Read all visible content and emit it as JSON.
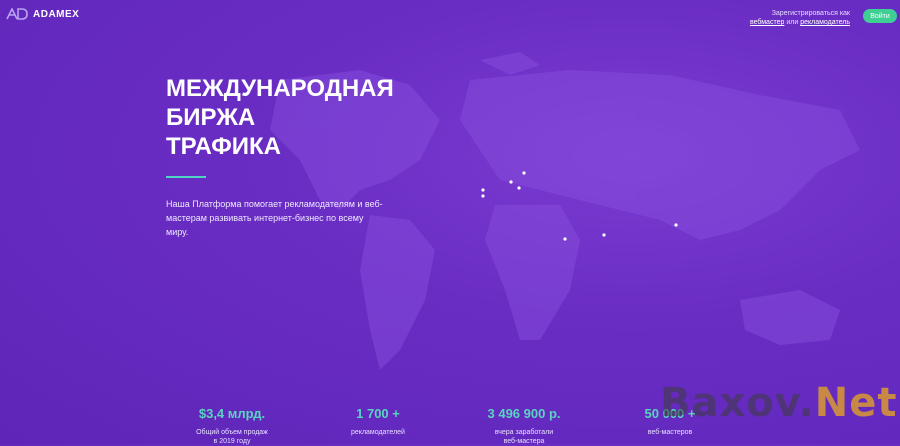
{
  "header": {
    "logo_text": "ADAMEX",
    "register_prefix": "Зарегистрироваться как",
    "register_webmaster": "вебмастер",
    "register_or": "или",
    "register_advertiser": "рекламодатель",
    "login_label": "Войти"
  },
  "hero": {
    "title_lines": [
      "МЕЖДУНАРОДНАЯ",
      "БИРЖА",
      "ТРАФИКА"
    ],
    "description": "Наша Платформа помогает рекламодателям и веб-мастерам развивать интернет-бизнес по всему миру."
  },
  "stats": [
    {
      "value": "$3,4 млрд.",
      "label_lines": [
        "Общий объем продаж",
        "в 2019 году"
      ]
    },
    {
      "value": "1 700 +",
      "label_lines": [
        "рекламодателей"
      ]
    },
    {
      "value": "3 496 900 р.",
      "label_lines": [
        "вчера заработали",
        "веб-мастера"
      ]
    },
    {
      "value": "50 000 +",
      "label_lines": [
        "веб-мастеров"
      ]
    }
  ],
  "watermark": {
    "prefix": "Baxov.",
    "suffix": "Net"
  },
  "colors": {
    "background": "#6a2dc4",
    "accent": "#59d4c0",
    "button": "#3fce93"
  }
}
